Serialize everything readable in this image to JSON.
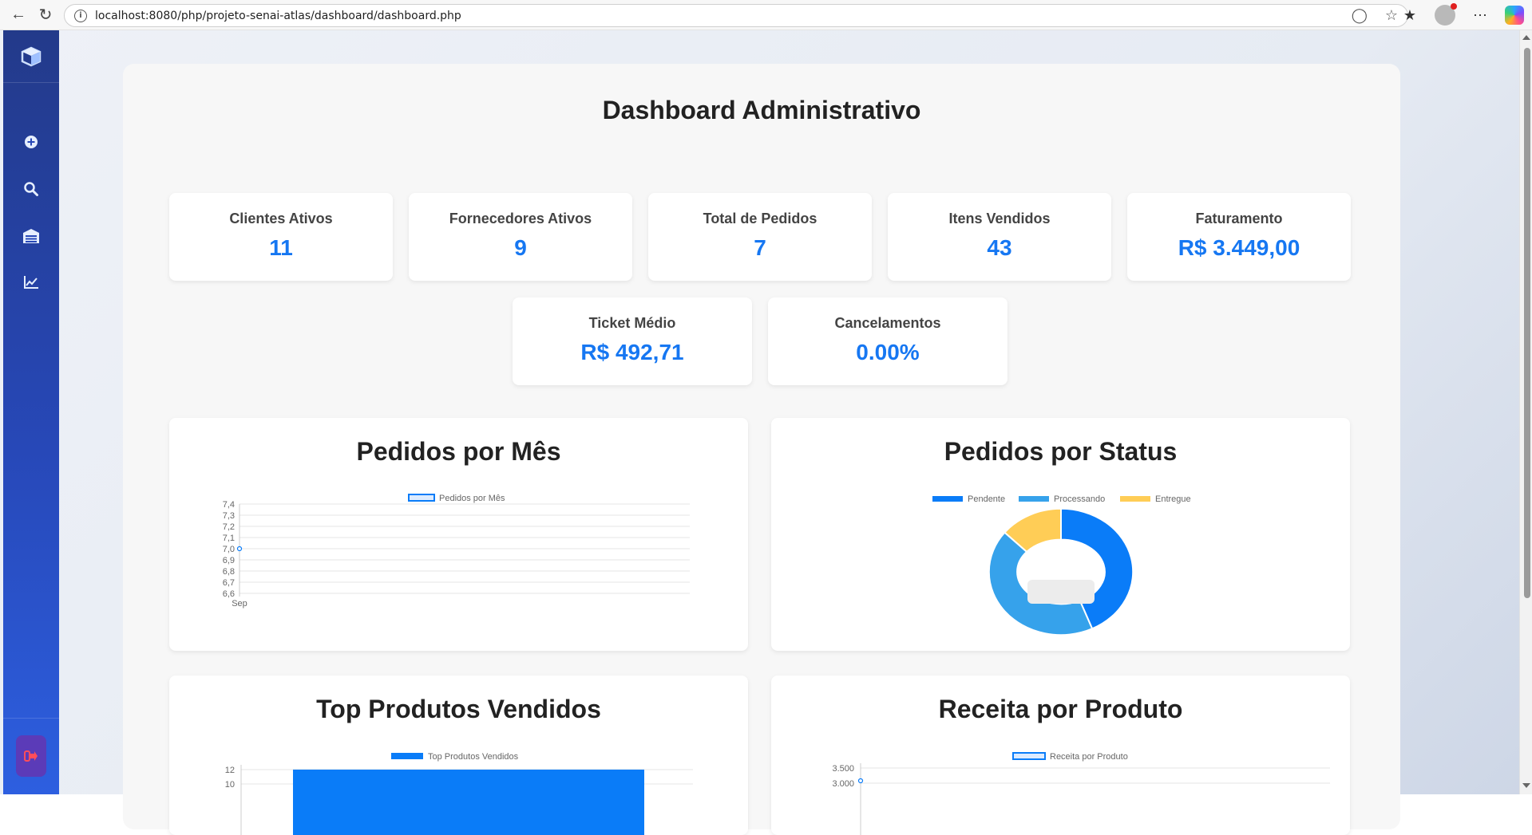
{
  "browser": {
    "url": "localhost:8080/php/projeto-senai-atlas/dashboard/dashboard.php"
  },
  "sidebar": {
    "items": [
      {
        "icon": "plus-circle-icon"
      },
      {
        "icon": "search-icon"
      },
      {
        "icon": "inventory-icon"
      },
      {
        "icon": "chart-line-icon"
      }
    ],
    "logout_icon": "logout-icon"
  },
  "dashboard": {
    "title": "Dashboard Administrativo",
    "kpis_row1": [
      {
        "label": "Clientes Ativos",
        "value": "11"
      },
      {
        "label": "Fornecedores Ativos",
        "value": "9"
      },
      {
        "label": "Total de Pedidos",
        "value": "7"
      },
      {
        "label": "Itens Vendidos",
        "value": "43"
      },
      {
        "label": "Faturamento",
        "value": "R$ 3.449,00"
      }
    ],
    "kpis_row2": [
      {
        "label": "Ticket Médio",
        "value": "R$ 492,71"
      },
      {
        "label": "Cancelamentos",
        "value": "0.00%"
      }
    ],
    "colors": {
      "accent": "#1677f2",
      "pendente": "#0a7cf8",
      "processando": "#36a2eb",
      "entregue": "#ffcd56"
    }
  },
  "chart_data": [
    {
      "type": "line",
      "title": "Pedidos por Mês",
      "series": [
        {
          "name": "Pedidos por Mês",
          "values": [
            7
          ]
        }
      ],
      "categories": [
        "Sep"
      ],
      "yticks": [
        "7,4",
        "7,3",
        "7,2",
        "7,1",
        "7,0",
        "6,9",
        "6,8",
        "6,7",
        "6,6"
      ],
      "ylim": [
        6.6,
        7.4
      ],
      "legend": "top"
    },
    {
      "type": "pie",
      "title": "Pedidos por Status",
      "categories": [
        "Pendente",
        "Processando",
        "Entregue"
      ],
      "values": [
        3,
        3,
        1
      ],
      "legend": "top"
    },
    {
      "type": "bar",
      "title": "Top Produtos Vendidos",
      "series": [
        {
          "name": "Top Produtos Vendidos",
          "values": [
            12
          ]
        }
      ],
      "yticks": [
        "12",
        "10"
      ],
      "legend": "top"
    },
    {
      "type": "line",
      "title": "Receita por Produto",
      "series": [
        {
          "name": "Receita por Produto",
          "values": [
            3000
          ]
        }
      ],
      "yticks": [
        "3.500",
        "3.000"
      ],
      "legend": "top"
    }
  ]
}
